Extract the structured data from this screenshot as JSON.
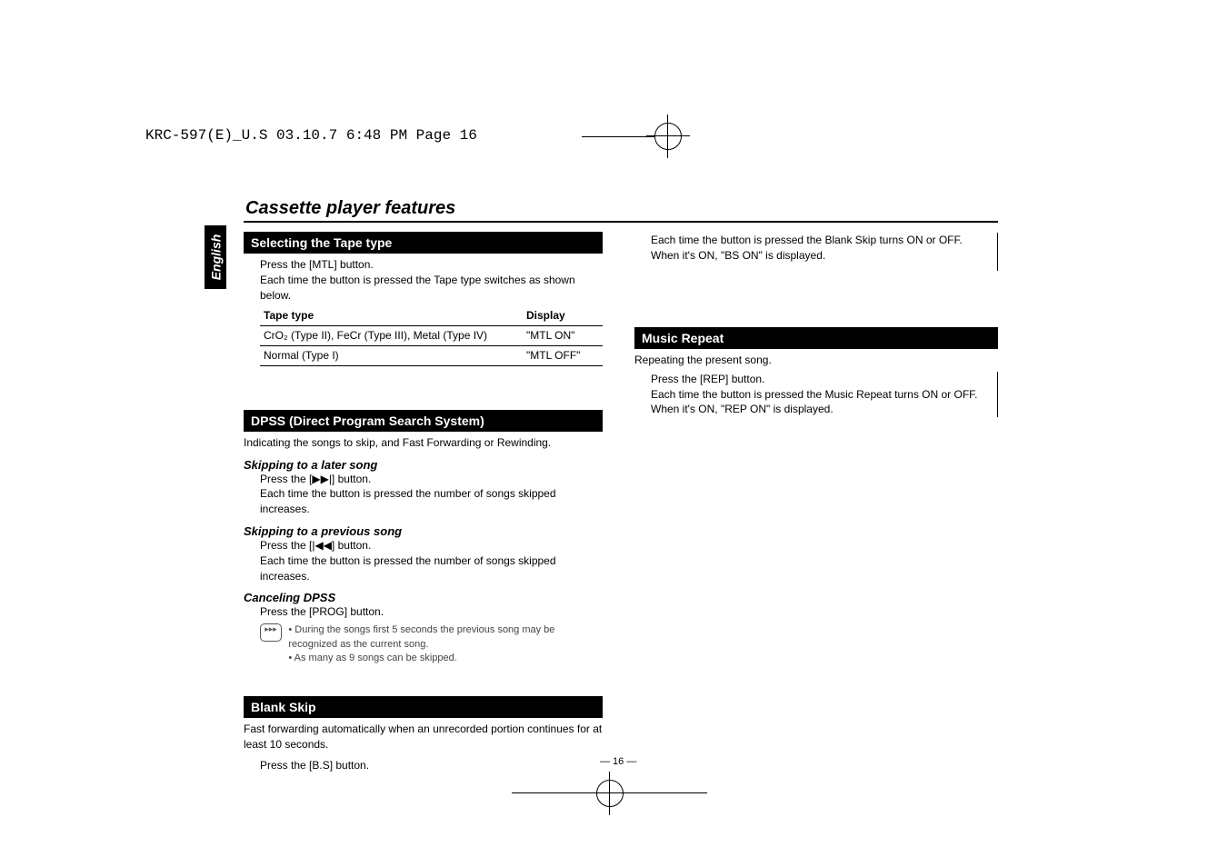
{
  "header": "KRC-597(E)_U.S  03.10.7  6:48 PM  Page 16",
  "sidebar": "English",
  "pageTitle": "Cassette player features",
  "left": {
    "tapeType": {
      "bar": "Selecting the Tape type",
      "press": "Press the [MTL] button.",
      "desc": "Each time the button is pressed the Tape type switches as shown below.",
      "th1": "Tape type",
      "th2": "Display",
      "r1c1": "CrO₂ (Type II), FeCr (Type III), Metal (Type IV)",
      "r1c2": "\"MTL ON\"",
      "r2c1": "Normal (Type I)",
      "r2c2": "\"MTL OFF\""
    },
    "dpss": {
      "bar": "DPSS (Direct Program Search System)",
      "lead": "Indicating the songs to skip, and Fast Forwarding or Rewinding.",
      "laterHead": "Skipping to a later song",
      "laterPress": "Press the [▶▶|] button.",
      "laterDesc": "Each time the button is pressed the number of songs skipped increases.",
      "prevHead": "Skipping to a previous song",
      "prevPress": "Press the [|◀◀] button.",
      "prevDesc": "Each time the button is pressed the number of songs skipped increases.",
      "cancelHead": "Canceling DPSS",
      "cancelPress": "Press the [PROG] button.",
      "note1": "During the songs first 5 seconds the previous song may be recognized as the current song.",
      "note2": "As many as 9 songs can be skipped."
    },
    "blank": {
      "bar": "Blank Skip",
      "lead": "Fast forwarding automatically when an unrecorded portion continues for at least 10 seconds.",
      "press": "Press the [B.S] button."
    }
  },
  "right": {
    "top1": "Each time the button is pressed the Blank Skip turns ON or OFF.",
    "top2": "When it's ON, \"BS ON\" is displayed.",
    "music": {
      "bar": "Music Repeat",
      "lead": "Repeating the present song.",
      "press": "Press the [REP] button.",
      "desc1": "Each time the button is pressed the Music Repeat turns ON or OFF.",
      "desc2": "When it's ON, \"REP ON\" is displayed."
    }
  },
  "pageNum": "— 16 —"
}
